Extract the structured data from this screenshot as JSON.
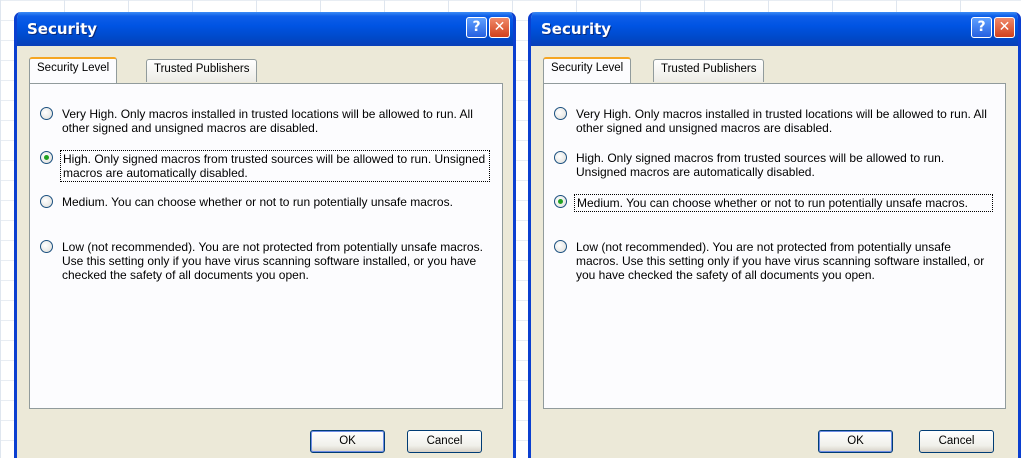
{
  "dialogs": [
    {
      "title": "Security",
      "help_glyph": "?",
      "close_glyph": "✕",
      "tabs": [
        {
          "label": "Security Level",
          "active": true
        },
        {
          "label": "Trusted Publishers",
          "active": false
        }
      ],
      "options": [
        {
          "label": "Very High. Only macros installed in trusted locations will be allowed to run. All other signed and unsigned macros are disabled.",
          "selected": false
        },
        {
          "label": "High. Only signed macros from trusted sources will be allowed to run. Unsigned macros are automatically disabled.",
          "selected": true
        },
        {
          "label": "Medium. You can choose whether or not to run potentially unsafe macros.",
          "selected": false
        },
        {
          "label": "Low (not recommended). You are not protected from potentially unsafe macros. Use this setting only if you have virus scanning software installed, or you have checked the safety of all documents you open.",
          "selected": false
        }
      ],
      "ok_label": "OK",
      "cancel_label": "Cancel"
    },
    {
      "title": "Security",
      "help_glyph": "?",
      "close_glyph": "✕",
      "tabs": [
        {
          "label": "Security Level",
          "active": true
        },
        {
          "label": "Trusted Publishers",
          "active": false
        }
      ],
      "options": [
        {
          "label": "Very High. Only macros installed in trusted locations will be allowed to run. All other signed and unsigned macros are disabled.",
          "selected": false
        },
        {
          "label": "High. Only signed macros from trusted sources will be allowed to run. Unsigned macros are automatically disabled.",
          "selected": false
        },
        {
          "label": "Medium. You can choose whether or not to run potentially unsafe macros.",
          "selected": true
        },
        {
          "label": "Low (not recommended). You are not protected from potentially unsafe macros. Use this setting only if you have virus scanning software installed, or you have checked the safety of all documents you open.",
          "selected": false
        }
      ],
      "ok_label": "OK",
      "cancel_label": "Cancel"
    }
  ],
  "colors": {
    "titlebar": "#0054e3",
    "dialog_face": "#ece9d8",
    "active_tab_accent": "#f5a622",
    "radio_dot": "#21a121",
    "close_button": "#d1401c"
  }
}
